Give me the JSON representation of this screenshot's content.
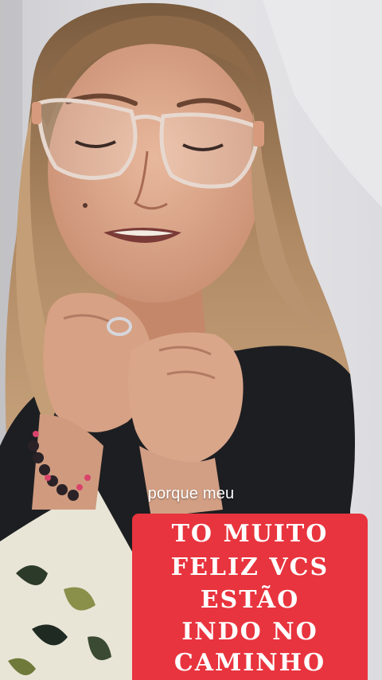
{
  "caption": "porque meu",
  "banner": {
    "lines": [
      "TO MUITO",
      "FELIZ VCS",
      "ESTÃO",
      "INDO NO",
      "CAMINHO"
    ],
    "background_color": "#e8343e",
    "text_color": "#ffffff"
  }
}
